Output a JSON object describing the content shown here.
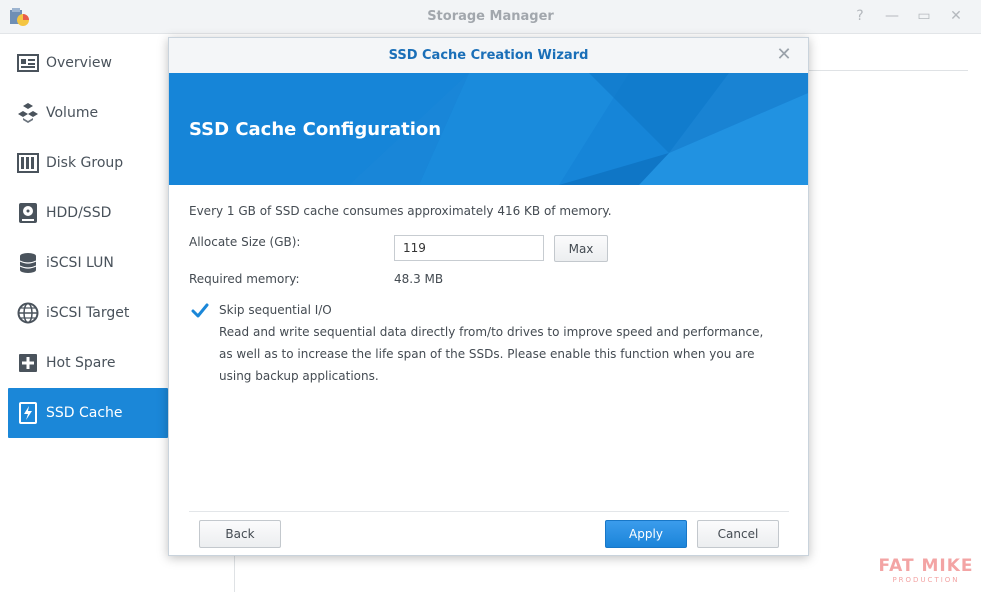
{
  "window": {
    "title": "Storage Manager"
  },
  "sidebar": {
    "items": [
      {
        "label": "Overview",
        "icon": "overview-icon"
      },
      {
        "label": "Volume",
        "icon": "volume-icon"
      },
      {
        "label": "Disk Group",
        "icon": "disk-group-icon"
      },
      {
        "label": "HDD/SSD",
        "icon": "hdd-icon"
      },
      {
        "label": "iSCSI LUN",
        "icon": "iscsi-lun-icon"
      },
      {
        "label": "iSCSI Target",
        "icon": "iscsi-target-icon"
      },
      {
        "label": "Hot Spare",
        "icon": "hot-spare-icon"
      },
      {
        "label": "SSD Cache",
        "icon": "ssd-cache-icon",
        "active": true
      }
    ]
  },
  "dialog": {
    "title": "SSD Cache Creation Wizard",
    "banner_title": "SSD Cache Configuration",
    "info_text": "Every 1 GB of SSD cache consumes approximately 416 KB of memory.",
    "allocate_label": "Allocate Size (GB):",
    "allocate_value": "119",
    "max_label": "Max",
    "required_memory_label": "Required memory:",
    "required_memory_value": "48.3 MB",
    "skip_label": "Skip sequential I/O",
    "skip_checked": true,
    "description_lines": [
      "Read and write sequential data directly from/to drives to improve speed and performance,",
      "as well as to increase the life span of the SSDs. Please enable this function when you are",
      "using backup applications."
    ],
    "back_label": "Back",
    "apply_label": "Apply",
    "cancel_label": "Cancel"
  },
  "watermark": {
    "line1": "FAT MIKE",
    "line2": "PRODUCTION"
  },
  "colors": {
    "accent": "#1b87d8",
    "banner": "#1685d8",
    "title": "#1a6fb8"
  }
}
